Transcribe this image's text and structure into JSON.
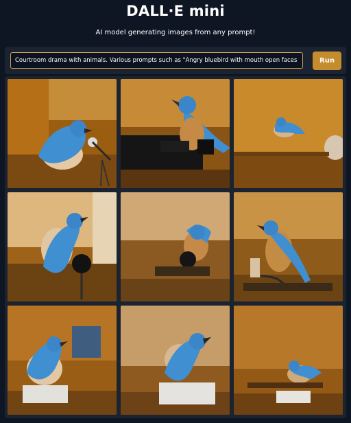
{
  "header": {
    "title": "DALL·E mini",
    "subtitle": "AI model generating images from any prompt!"
  },
  "prompt": {
    "value": "Courtroom drama with animals. Various prompts such as \"Angry bluebird with mouth open faces a microphone",
    "run_label": "Run"
  },
  "gallery": {
    "columns": 3,
    "rows": 3,
    "image_count": 9
  },
  "colors": {
    "background": "#0f1623",
    "panel": "#1b2331",
    "accent": "#c48c2c",
    "input_border": "#c9a15a",
    "bluebird": "#3f8fd1",
    "wood": "#b7791f"
  }
}
